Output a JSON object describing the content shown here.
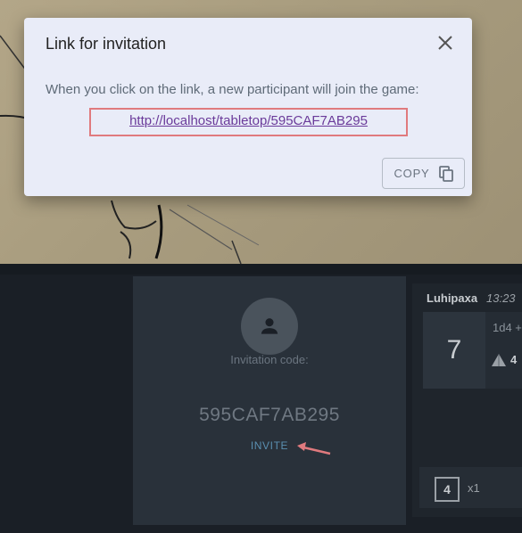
{
  "dialog": {
    "title": "Link for invitation",
    "message": "When you click on the link, a new participant will join the game:",
    "link": "http://localhost/tabletop/595CAF7AB295",
    "copy_label": "COPY",
    "close_icon": "close-icon",
    "copy_icon": "copy-icon"
  },
  "player_slot": {
    "avatar_icon": "person-icon",
    "invite_label": "Invitation code:",
    "invite_code": "595CAF7AB295",
    "invite_button": "INVITE"
  },
  "chat": {
    "author": "Luhipaxa",
    "time": "13:23",
    "roll_total": "7",
    "roll_formula": "1d4 +",
    "die_value": "4",
    "die_icon": "d4-triangle-icon",
    "tray_die": "4",
    "tray_count": "x1"
  },
  "colors": {
    "accent_link": "#6a3a9a",
    "highlight_box": "#e07a7e",
    "invite_button": "#5a8fb0"
  }
}
